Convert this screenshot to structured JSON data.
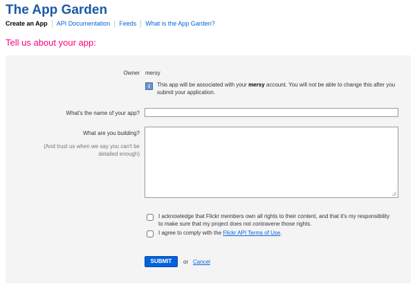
{
  "header": {
    "title": "The App Garden",
    "nav": [
      {
        "label": "Create an App"
      },
      {
        "label": "API Documentation"
      },
      {
        "label": "Feeds"
      },
      {
        "label": "What is the App Garden?"
      }
    ]
  },
  "page": {
    "heading": "Tell us about your app:"
  },
  "form": {
    "owner_label": "Owner",
    "owner_value": "mersy",
    "info_before": "This app will be associated with your ",
    "info_bold": "mersy",
    "info_after": " account. You will not be able to change this after you submit your application.",
    "name_label": "What's the name of your app?",
    "name_value": "",
    "build_label": "What are you building?",
    "build_hint": "(And trust us when we say you can't be detailed enough)",
    "build_value": "",
    "ack_text": "I acknowledge that Flickr members own all rights to their content, and that it's my responsibility to make sure that my project does not contravene those rights.",
    "terms_before": "I agree to comply with the ",
    "terms_link": "Flickr API Terms of Use",
    "terms_after": ".",
    "submit_label": "SUBMIT",
    "or_text": "or",
    "cancel_label": "Cancel"
  },
  "colors": {
    "brand_title": "#1a5aa6",
    "link": "#0063dc",
    "heading": "#ff0084",
    "panel_bg": "#f4f4f4",
    "button_bg": "#0063dc"
  },
  "icons": {
    "info": "info-icon",
    "resize": "resize-grip-icon"
  }
}
